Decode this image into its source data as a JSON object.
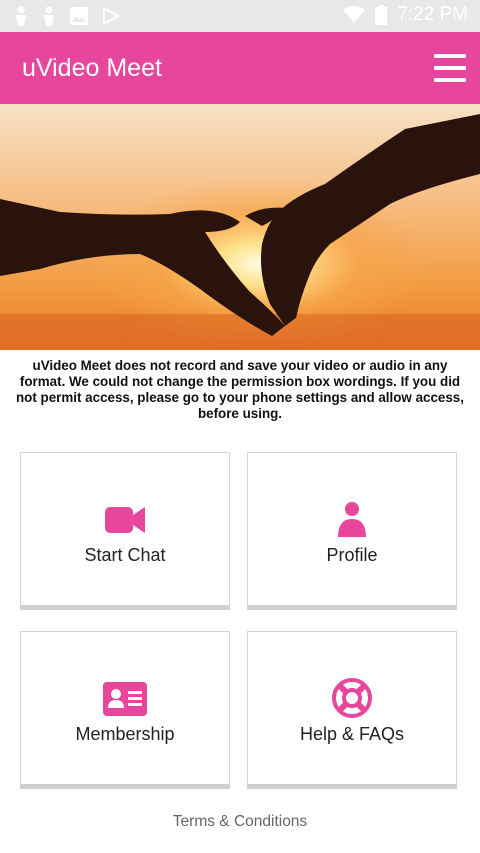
{
  "status_bar": {
    "time": "7:22 PM",
    "icons": [
      "person-icon",
      "person-icon",
      "image-icon",
      "play-store-icon",
      "wifi-icon",
      "battery-icon"
    ]
  },
  "app_bar": {
    "title": "uVideo Meet",
    "menu_icon": "hamburger-menu-icon"
  },
  "hero": {
    "image": "heart-hands-sunset"
  },
  "notice": {
    "text": "uVideo Meet does not record and save your video or audio in any format. We could not change the permission box wordings. If you did not permit access, please go to your phone settings and allow access, before using."
  },
  "tiles": [
    {
      "label": "Start Chat",
      "icon": "video-camera-icon"
    },
    {
      "label": "Profile",
      "icon": "user-icon"
    },
    {
      "label": "Membership",
      "icon": "id-card-icon"
    },
    {
      "label": "Help & FAQs",
      "icon": "life-ring-icon"
    }
  ],
  "footer": {
    "terms_label": "Terms & Conditions"
  },
  "colors": {
    "primary": "#e6469b",
    "status_bar": "#e8e8e8"
  }
}
